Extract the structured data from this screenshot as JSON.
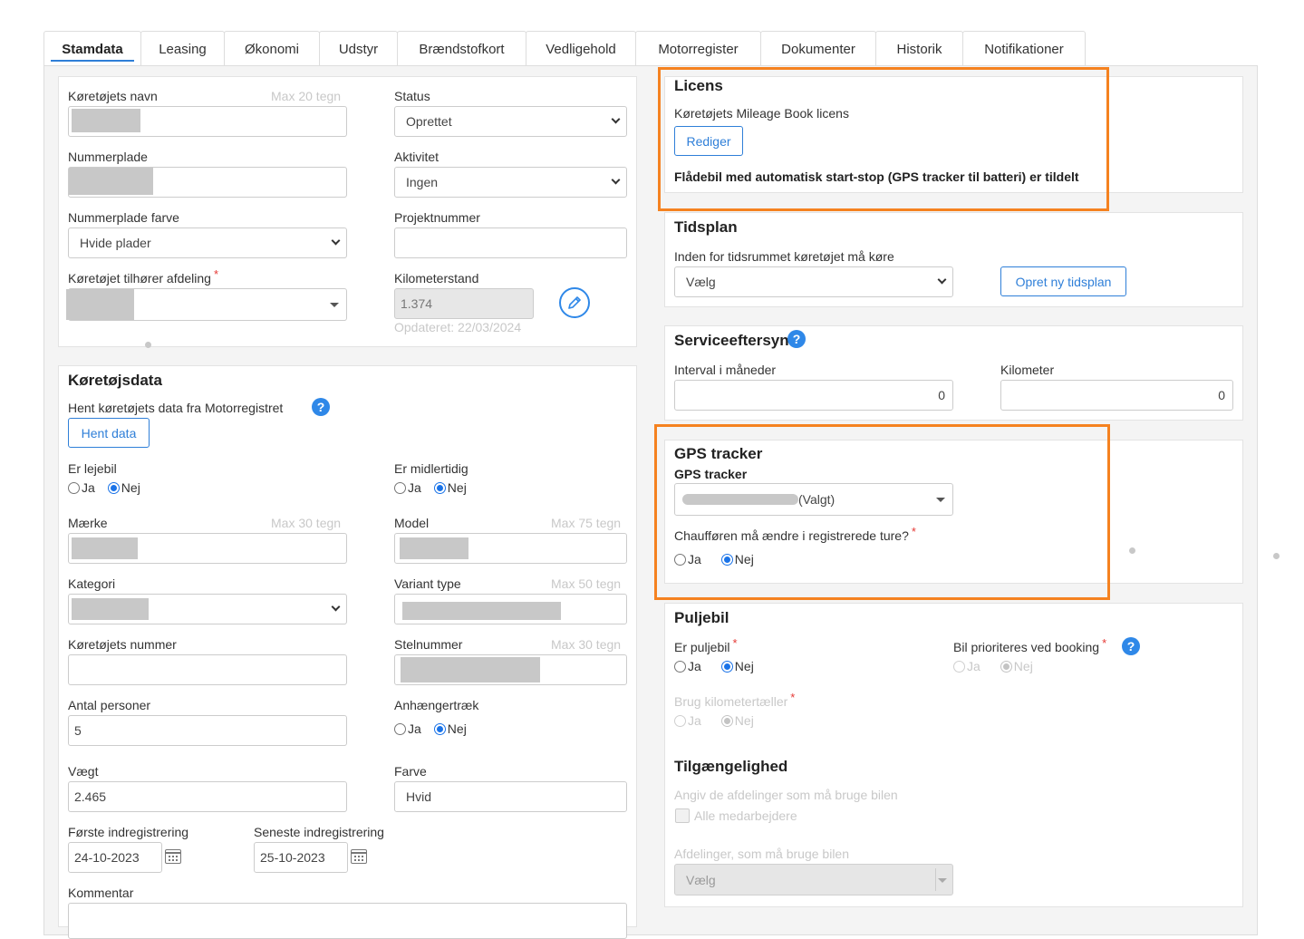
{
  "tabs": [
    "Stamdata",
    "Leasing",
    "Økonomi",
    "Udstyr",
    "Brændstofkort",
    "Vedligehold",
    "Motorregister",
    "Dokumenter",
    "Historik",
    "Notifikationer"
  ],
  "basic": {
    "name_label": "Køretøjets navn",
    "name_hint": "Max 20 tegn",
    "status_label": "Status",
    "status_value": "Oprettet",
    "plate_label": "Nummerplade",
    "activity_label": "Aktivitet",
    "activity_value": "Ingen",
    "plate_color_label": "Nummerplade farve",
    "plate_color_value": "Hvide plader",
    "project_label": "Projektnummer",
    "department_label": "Køretøjet tilhører afdeling",
    "km_label": "Kilometerstand",
    "km_value": "1.374",
    "km_updated": "Opdateret: 22/03/2024"
  },
  "vehicle": {
    "title": "Køretøjsdata",
    "fetch_label": "Hent køretøjets data fra Motorregistret",
    "fetch_button": "Hent data",
    "rental_label": "Er lejebil",
    "temp_label": "Er midlertidig",
    "yes": "Ja",
    "no": "Nej",
    "brand_label": "Mærke",
    "brand_hint": "Max 30 tegn",
    "model_label": "Model",
    "model_hint": "Max 75 tegn",
    "category_label": "Kategori",
    "variant_label": "Variant type",
    "variant_hint": "Max 50 tegn",
    "number_label": "Køretøjets nummer",
    "vin_label": "Stelnummer",
    "vin_hint": "Max 30 tegn",
    "persons_label": "Antal personer",
    "persons_value": "5",
    "towbar_label": "Anhængertræk",
    "weight_label": "Vægt",
    "weight_value": "2.465",
    "color_label": "Farve",
    "color_value": "Hvid",
    "first_reg_label": "Første indregistrering",
    "first_reg_value": "24-10-2023",
    "last_reg_label": "Seneste indregistrering",
    "last_reg_value": "25-10-2023",
    "comment_label": "Kommentar"
  },
  "license": {
    "title": "Licens",
    "subtitle": "Køretøjets Mileage Book licens",
    "edit_button": "Rediger",
    "note": "Flådebil med automatisk start-stop (GPS tracker til batteri) er tildelt"
  },
  "schedule": {
    "title": "Tidsplan",
    "label": "Inden for tidsrummet køretøjet må køre",
    "select_value": "Vælg",
    "new_button": "Opret ny tidsplan"
  },
  "service": {
    "title": "Serviceeftersyn",
    "interval_label": "Interval i måneder",
    "interval_value": "0",
    "km_label": "Kilometer",
    "km_value": "0"
  },
  "gps": {
    "title": "GPS tracker",
    "field_label": "GPS tracker",
    "selected_suffix": "(Valgt)",
    "driver_label": "Chaufføren må ændre i registrerede ture?"
  },
  "pool": {
    "title": "Puljebil",
    "is_pool_label": "Er puljebil",
    "priority_label": "Bil prioriteres ved booking",
    "km_counter_label": "Brug kilometertæller",
    "availability_title": "Tilgængelighed",
    "availability_desc": "Angiv de afdelinger som må bruge bilen",
    "all_employees": "Alle medarbejdere",
    "departments_label": "Afdelinger, som må bruge bilen",
    "departments_value": "Vælg"
  },
  "colors": {
    "accent": "#2f7fd8",
    "highlight": "#f58220",
    "required": "#e53935"
  }
}
